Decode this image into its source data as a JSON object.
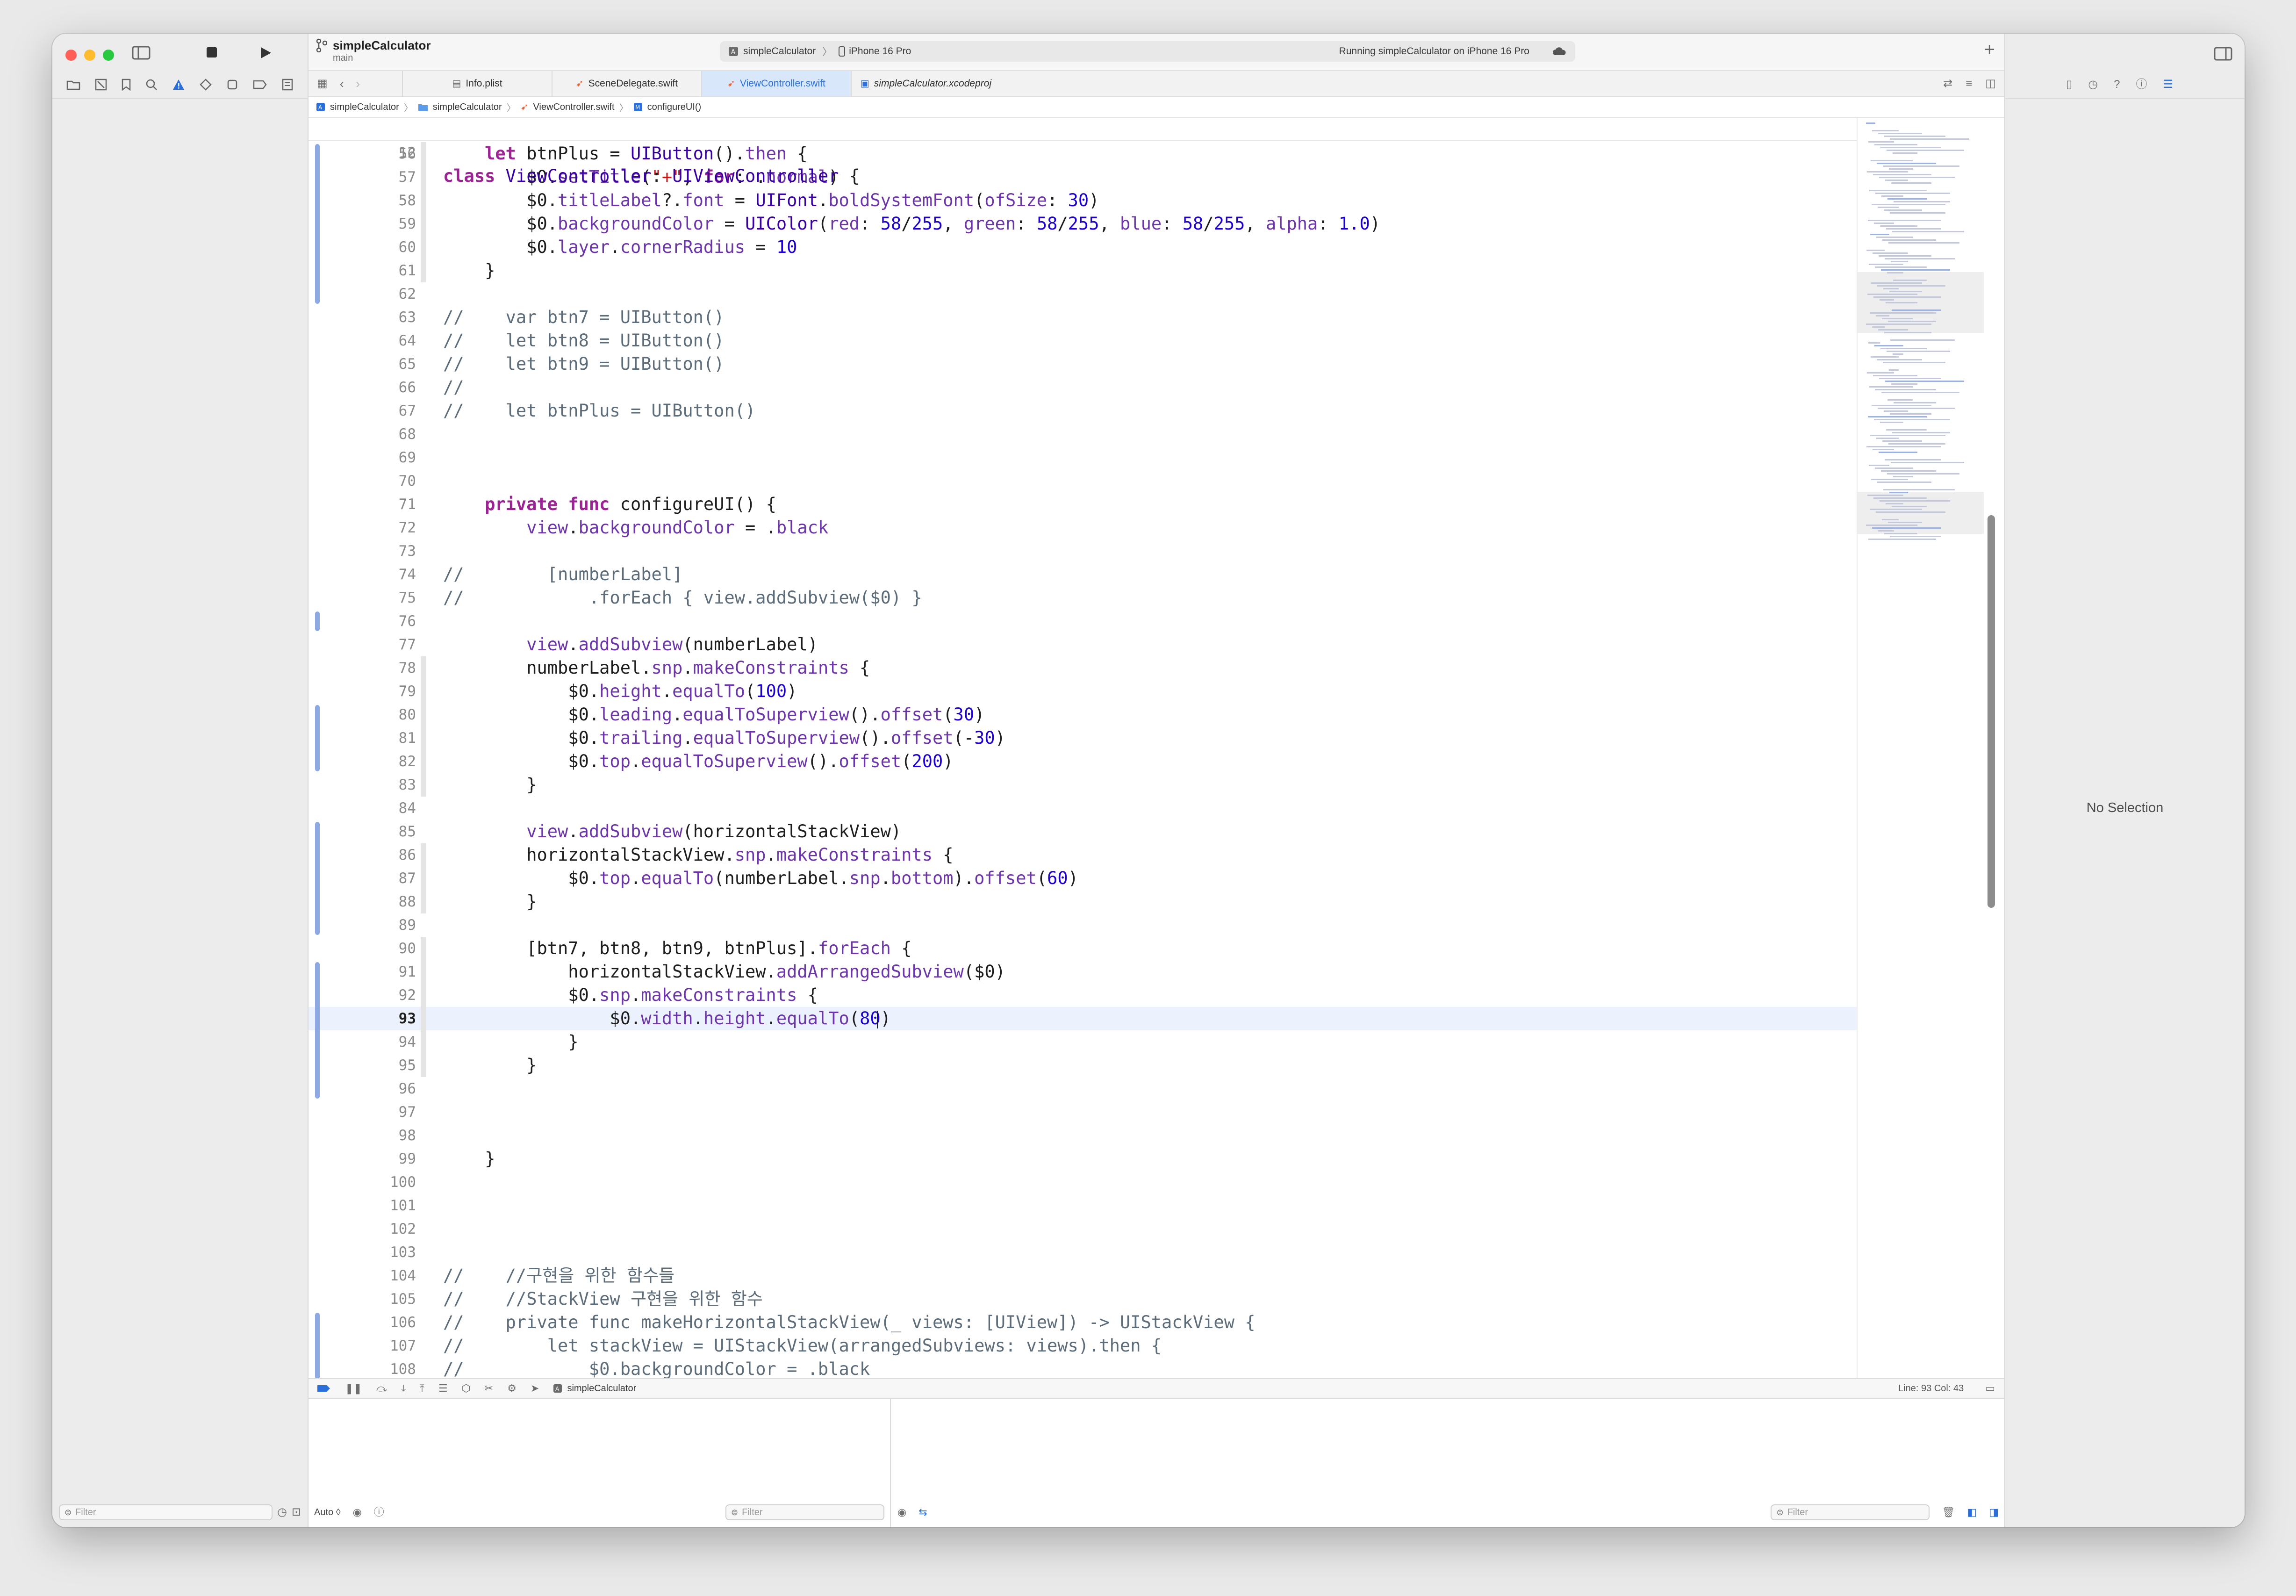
{
  "window": {
    "project": "simpleCalculator",
    "branch": "main"
  },
  "activity": {
    "scheme": "simpleCalculator",
    "destination": "iPhone 16 Pro",
    "status": "Running simpleCalculator on iPhone 16 Pro"
  },
  "tabs": [
    {
      "label": "Info.plist",
      "icon": "plist-icon",
      "active": false,
      "italic": false
    },
    {
      "label": "SceneDelegate.swift",
      "icon": "swift-icon",
      "active": false,
      "italic": false
    },
    {
      "label": "ViewController.swift",
      "icon": "swift-icon",
      "active": true,
      "italic": false
    },
    {
      "label": "simpleCalculator.xcodeproj",
      "icon": "xcodeproj-icon",
      "active": false,
      "italic": true
    }
  ],
  "jumpbar": [
    "simpleCalculator",
    "simpleCalculator",
    "ViewController.swift",
    "configureUI()"
  ],
  "sticky": {
    "number": "12",
    "text": "class ViewController: UIViewController {"
  },
  "editor": {
    "current_line": 93,
    "lines": [
      {
        "n": "56",
        "text": "    let btnPlus = UIButton().then {"
      },
      {
        "n": "57",
        "text": "        $0.setTitle(\"+\", for: .normal)"
      },
      {
        "n": "58",
        "text": "        $0.titleLabel?.font = UIFont.boldSystemFont(ofSize: 30)"
      },
      {
        "n": "59",
        "text": "        $0.backgroundColor = UIColor(red: 58/255, green: 58/255, blue: 58/255, alpha: 1.0)"
      },
      {
        "n": "60",
        "text": "        $0.layer.cornerRadius = 10"
      },
      {
        "n": "61",
        "text": "    }"
      },
      {
        "n": "62",
        "text": ""
      },
      {
        "n": "63",
        "text": "//    var btn7 = UIButton()"
      },
      {
        "n": "64",
        "text": "//    let btn8 = UIButton()"
      },
      {
        "n": "65",
        "text": "//    let btn9 = UIButton()"
      },
      {
        "n": "66",
        "text": "//"
      },
      {
        "n": "67",
        "text": "//    let btnPlus = UIButton()"
      },
      {
        "n": "68",
        "text": ""
      },
      {
        "n": "69",
        "text": ""
      },
      {
        "n": "70",
        "text": ""
      },
      {
        "n": "71",
        "text": "    private func configureUI() {"
      },
      {
        "n": "72",
        "text": "        view.backgroundColor = .black"
      },
      {
        "n": "73",
        "text": ""
      },
      {
        "n": "74",
        "text": "//        [numberLabel]"
      },
      {
        "n": "75",
        "text": "//            .forEach { view.addSubview($0) }"
      },
      {
        "n": "76",
        "text": ""
      },
      {
        "n": "77",
        "text": "        view.addSubview(numberLabel)"
      },
      {
        "n": "78",
        "text": "        numberLabel.snp.makeConstraints {"
      },
      {
        "n": "79",
        "text": "            $0.height.equalTo(100)"
      },
      {
        "n": "80",
        "text": "            $0.leading.equalToSuperview().offset(30)"
      },
      {
        "n": "81",
        "text": "            $0.trailing.equalToSuperview().offset(-30)"
      },
      {
        "n": "82",
        "text": "            $0.top.equalToSuperview().offset(200)"
      },
      {
        "n": "83",
        "text": "        }"
      },
      {
        "n": "84",
        "text": ""
      },
      {
        "n": "85",
        "text": "        view.addSubview(horizontalStackView)"
      },
      {
        "n": "86",
        "text": "        horizontalStackView.snp.makeConstraints {"
      },
      {
        "n": "87",
        "text": "            $0.top.equalTo(numberLabel.snp.bottom).offset(60)"
      },
      {
        "n": "88",
        "text": "        }"
      },
      {
        "n": "89",
        "text": ""
      },
      {
        "n": "90",
        "text": "        [btn7, btn8, btn9, btnPlus].forEach {"
      },
      {
        "n": "91",
        "text": "            horizontalStackView.addArrangedSubview($0)"
      },
      {
        "n": "92",
        "text": "            $0.snp.makeConstraints {"
      },
      {
        "n": "93",
        "text": "                $0.width.height.equalTo(80)"
      },
      {
        "n": "94",
        "text": "            }"
      },
      {
        "n": "95",
        "text": "        }"
      },
      {
        "n": "96",
        "text": ""
      },
      {
        "n": "97",
        "text": ""
      },
      {
        "n": "98",
        "text": ""
      },
      {
        "n": "99",
        "text": "    }"
      },
      {
        "n": "100",
        "text": ""
      },
      {
        "n": "101",
        "text": ""
      },
      {
        "n": "102",
        "text": ""
      },
      {
        "n": "103",
        "text": ""
      },
      {
        "n": "104",
        "text": "//    //구현을 위한 함수들"
      },
      {
        "n": "105",
        "text": "//    //StackView 구현을 위한 함수"
      },
      {
        "n": "106",
        "text": "//    private func makeHorizontalStackView(_ views: [UIView]) -> UIStackView {"
      },
      {
        "n": "107",
        "text": "//        let stackView = UIStackView(arrangedSubviews: views).then {"
      },
      {
        "n": "108",
        "text": "//            $0.backgroundColor = .black"
      }
    ]
  },
  "debug": {
    "process": "simpleCalculator",
    "position": "Line: 93  Col: 43"
  },
  "filters": {
    "navigator": "Filter",
    "variables": "Filter",
    "console": "Filter",
    "auto_label": "Auto ◊"
  },
  "inspector": {
    "empty_text": "No Selection"
  },
  "colors": {
    "accent": "#2a6fdb",
    "keyword": "#9b2393",
    "type": "#3900a0",
    "number": "#1c00cf",
    "string": "#c41a16",
    "comment": "#5d6c79"
  }
}
